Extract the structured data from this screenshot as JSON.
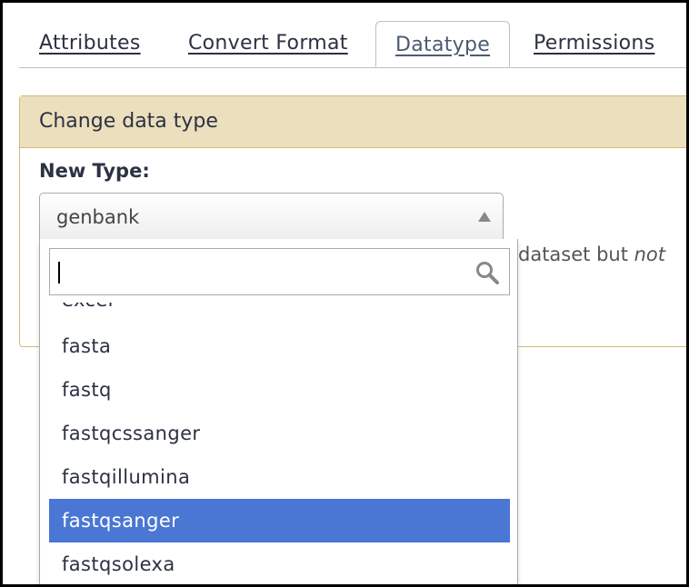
{
  "tabs": [
    {
      "label": "Attributes",
      "active": false
    },
    {
      "label": "Convert Format",
      "active": false
    },
    {
      "label": "Datatype",
      "active": true
    },
    {
      "label": "Permissions",
      "active": false
    }
  ],
  "panel": {
    "header": "Change data type",
    "field_label": "New Type:",
    "help_text_prefix": "dataset but ",
    "help_text_emphasis": "not"
  },
  "select": {
    "value": "genbank"
  },
  "dropdown": {
    "search_value": "",
    "options": [
      "excel",
      "fasta",
      "fastq",
      "fastqcssanger",
      "fastqillumina",
      "fastqsanger",
      "fastqsolexa"
    ],
    "highlighted": "fastqsanger"
  },
  "colors": {
    "highlight": "#4a76d4",
    "panel_header_bg": "#ebdfbd",
    "panel_border": "#d5b979"
  }
}
